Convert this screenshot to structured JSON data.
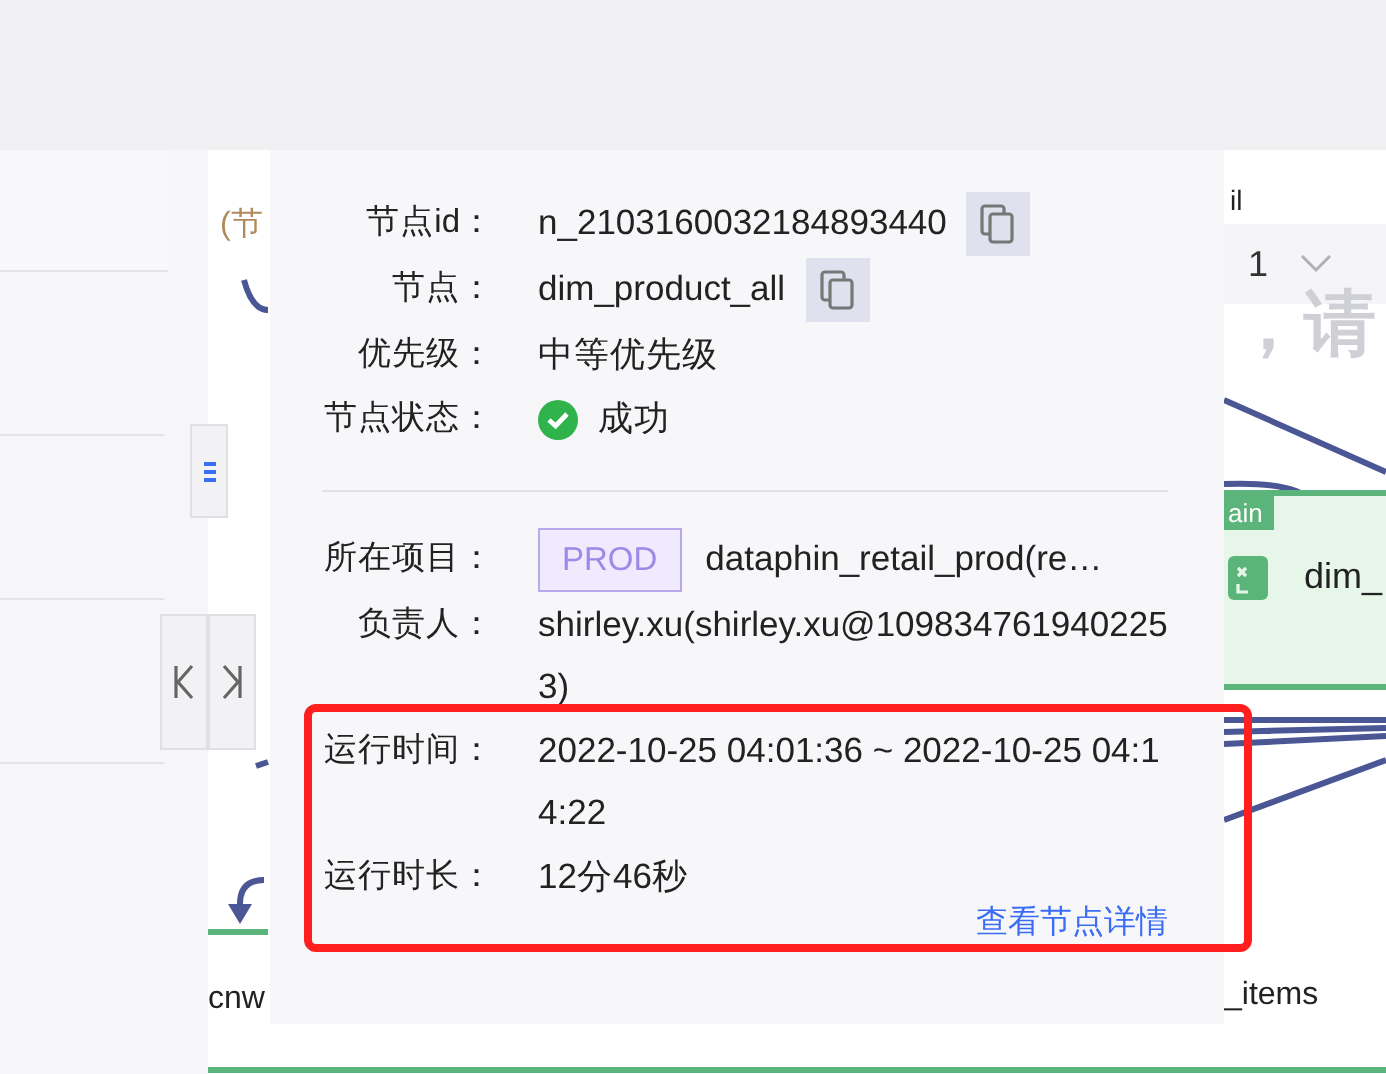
{
  "canvas": {
    "top_label": "(节",
    "right_label": "il",
    "dropdown": {
      "value": "1"
    },
    "hint": "，请",
    "nodes": [
      {
        "kind": "main",
        "name": "dim_",
        "tag": "ain"
      },
      {
        "kind": "plain",
        "name": "_items"
      },
      {
        "kind": "plain",
        "name": "cnw"
      }
    ]
  },
  "popup": {
    "fields": [
      {
        "kind": "copy",
        "label": "节点id：",
        "value": "n_2103160032184893440"
      },
      {
        "kind": "copy",
        "label": "节点：",
        "value": "dim_product_all"
      },
      {
        "kind": "text",
        "label": "优先级：",
        "value": "中等优先级"
      },
      {
        "kind": "status",
        "label": "节点状态：",
        "value": "成功"
      },
      {
        "kind": "divider"
      },
      {
        "kind": "project",
        "label": "所在项目：",
        "tag": "PROD",
        "value": "dataphin_retail_prod(re…"
      },
      {
        "kind": "text",
        "label": "负责人：",
        "value": "shirley.xu(shirley.xu@1098347619402253)"
      },
      {
        "kind": "text",
        "label": "运行时间：",
        "value": "2022-10-25 04:01:36 ~ 2022-10-25 04:14:22"
      },
      {
        "kind": "text",
        "label": "运行时长：",
        "value": "12分46秒"
      }
    ],
    "link": "查看节点详情"
  }
}
